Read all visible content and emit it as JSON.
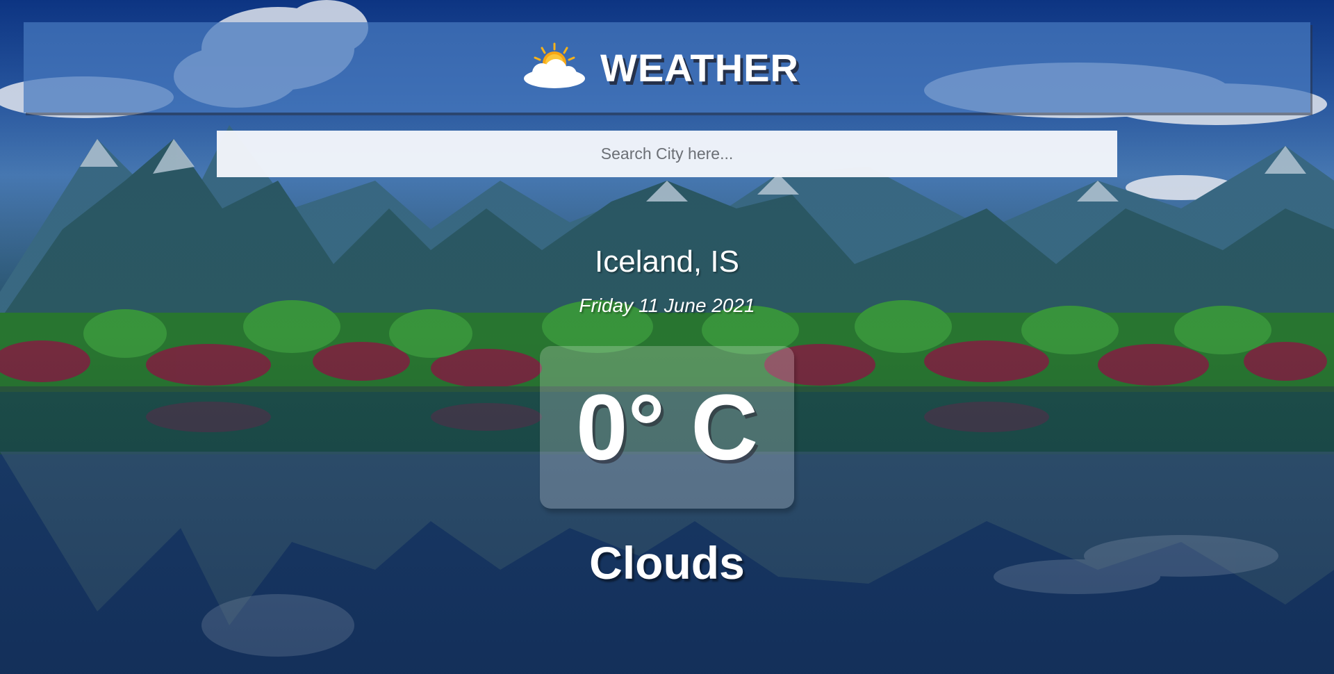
{
  "app": {
    "title": "WEATHER",
    "logo_icon": "sun-behind-cloud-icon"
  },
  "search": {
    "placeholder": "Search City here...",
    "value": ""
  },
  "weather": {
    "location": "Iceland, IS",
    "date": "Friday 11 June 2021",
    "temperature": "0° C",
    "condition": "Clouds"
  },
  "colors": {
    "header_bg": "#4678be",
    "search_bg": "#f5f8fc",
    "text": "#ffffff"
  }
}
